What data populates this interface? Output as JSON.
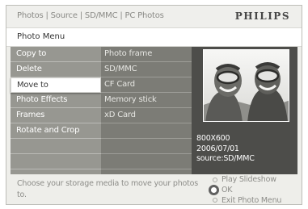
{
  "breadcrumb": "Photos | Source | SD/MMC | PC Photos",
  "brand": "PHILIPS",
  "menu_title": "Photo Menu",
  "menu_items": [
    {
      "label": "Copy to"
    },
    {
      "label": "Delete"
    },
    {
      "label": "Move to",
      "selected": true
    },
    {
      "label": "Photo Effects"
    },
    {
      "label": "Frames"
    },
    {
      "label": "Rotate and Crop"
    }
  ],
  "submenu_items": [
    {
      "label": "Photo frame"
    },
    {
      "label": "SD/MMC"
    },
    {
      "label": "CF Card"
    },
    {
      "label": "Memory stick"
    },
    {
      "label": "xD Card"
    }
  ],
  "preview": {
    "resolution": "800X600",
    "date": "2006/07/01",
    "source": "source:SD/MMC"
  },
  "hint": "Choose your storage media to move your photos to.",
  "controls": {
    "play": "Play Slideshow",
    "ok": "OK",
    "exit": "Exit Photo Menu"
  },
  "colors": {
    "menu_column": "#979791",
    "submenu_column": "#7c7c76",
    "preview_panel": "#4d4d4a",
    "background": "#eeeeea"
  }
}
